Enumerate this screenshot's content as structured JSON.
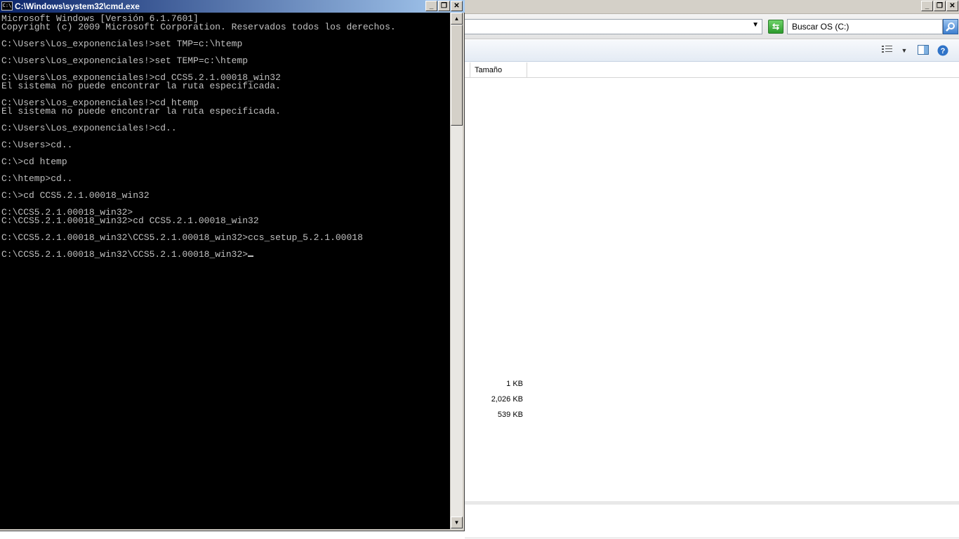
{
  "cmd": {
    "title": "C:\\Windows\\system32\\cmd.exe",
    "icon": "C:\\",
    "lines": [
      "Microsoft Windows [Versión 6.1.7601]",
      "Copyright (c) 2009 Microsoft Corporation. Reservados todos los derechos.",
      "",
      "C:\\Users\\Los_exponenciales!>set TMP=c:\\htemp",
      "",
      "C:\\Users\\Los_exponenciales!>set TEMP=c:\\htemp",
      "",
      "C:\\Users\\Los_exponenciales!>cd CCS5.2.1.00018_win32",
      "El sistema no puede encontrar la ruta especificada.",
      "",
      "C:\\Users\\Los_exponenciales!>cd htemp",
      "El sistema no puede encontrar la ruta especificada.",
      "",
      "C:\\Users\\Los_exponenciales!>cd..",
      "",
      "C:\\Users>cd..",
      "",
      "C:\\>cd htemp",
      "",
      "C:\\htemp>cd..",
      "",
      "C:\\>cd CCS5.2.1.00018_win32",
      "",
      "C:\\CCS5.2.1.00018_win32>",
      "C:\\CCS5.2.1.00018_win32>cd CCS5.2.1.00018_win32",
      "",
      "C:\\CCS5.2.1.00018_win32\\CCS5.2.1.00018_win32>ccs_setup_5.2.1.00018",
      "",
      "C:\\CCS5.2.1.00018_win32\\CCS5.2.1.00018_win32>"
    ]
  },
  "explorer": {
    "search_placeholder": "Buscar OS (C:)",
    "column_size": "Tamaño",
    "sizes": [
      "1 KB",
      "2,026 KB",
      "539 KB"
    ]
  },
  "window_controls": {
    "minimize": "_",
    "maximize": "❐",
    "close": "✕"
  },
  "colors": {
    "cmd_bg": "#000000",
    "cmd_text": "#c0c0c0",
    "titlebar_start": "#0a246a",
    "titlebar_end": "#a6caf0"
  }
}
